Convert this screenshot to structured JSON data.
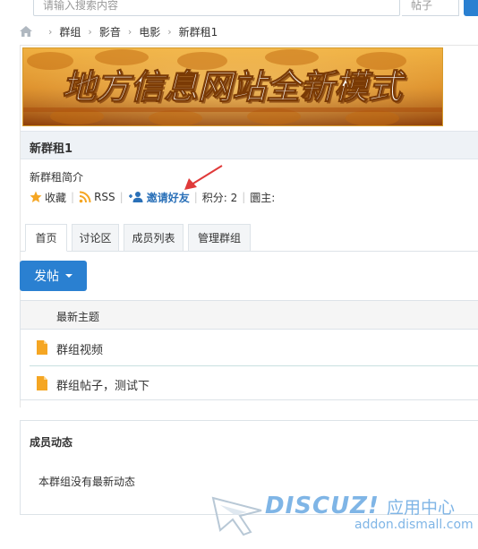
{
  "search": {
    "placeholder": "请输入搜索内容",
    "type_label": "帖子"
  },
  "breadcrumb": {
    "items": [
      "群组",
      "影音",
      "电影",
      "新群租1"
    ]
  },
  "banner": {
    "text": "地方信息网站全新模式"
  },
  "group": {
    "name": "新群租1",
    "intro": "新群租简介",
    "favorite_label": "收藏",
    "rss_label": "RSS",
    "invite_label": "邀请好友",
    "points_label": "积分: 2",
    "owner_label": "圜主:"
  },
  "tabs": [
    {
      "label": "首页",
      "active": true
    },
    {
      "label": "讨论区",
      "active": false
    },
    {
      "label": "成员列表",
      "active": false
    },
    {
      "label": "管理群组",
      "active": false
    }
  ],
  "post_button": {
    "label": "发帖"
  },
  "topics": {
    "header": "最新主题",
    "rows": [
      {
        "title": "群组视频"
      },
      {
        "title": "群组帖子，测试下"
      }
    ]
  },
  "activity": {
    "title": "成员动态",
    "empty_text": "本群组没有最新动态"
  },
  "watermark": {
    "brand": "DISCUZ!",
    "cn": "应用中心",
    "domain": "addon.dismall.com"
  },
  "colors": {
    "accent": "#2a80d1",
    "link": "#2a70b8",
    "file_icon": "#f5a623",
    "star": "#f5a623",
    "arrow": "#e03a3a",
    "banner_text": "#ffffff",
    "banner_bg": "#d8821a"
  }
}
